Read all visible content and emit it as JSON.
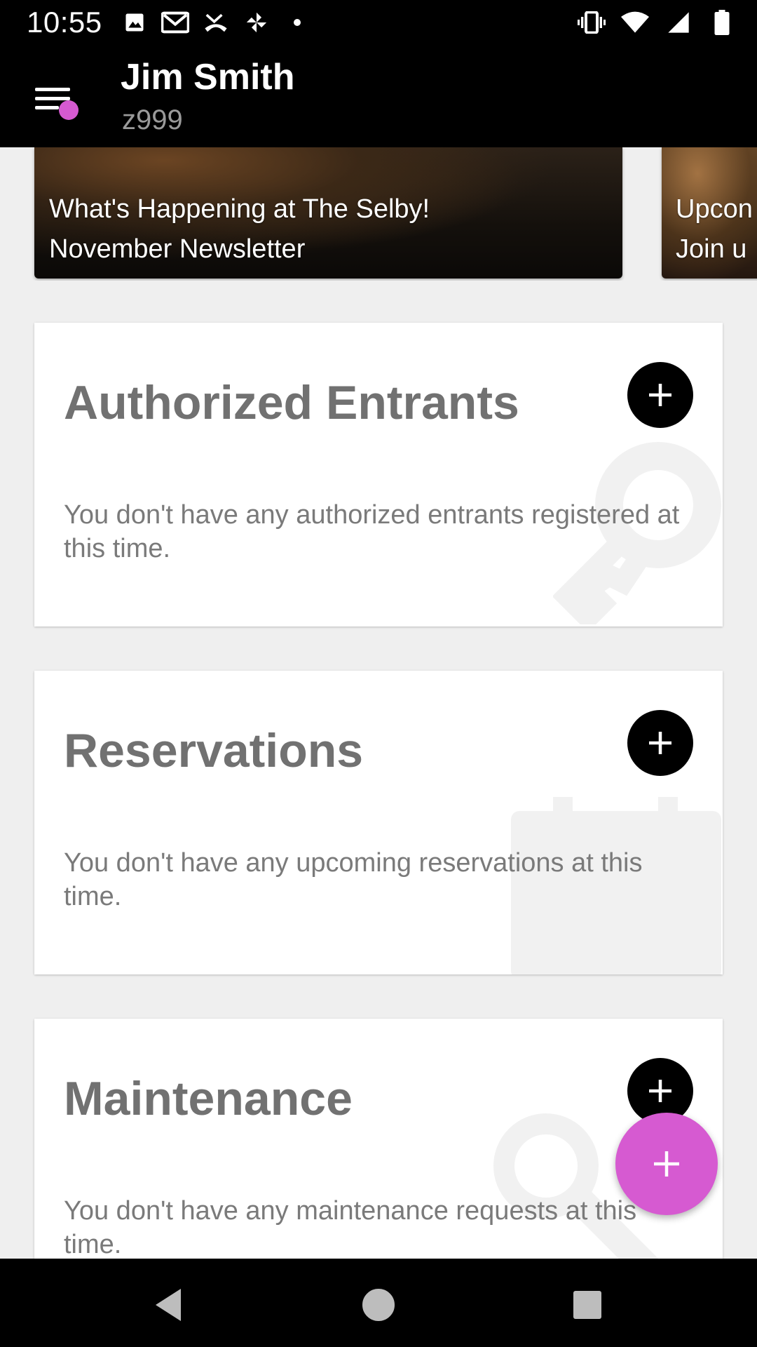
{
  "status_bar": {
    "time": "10:55",
    "left_icons": [
      "image-icon",
      "gmail-icon",
      "missed-call-icon",
      "pinwheel-icon",
      "dot-icon"
    ],
    "right_icons": [
      "vibrate-icon",
      "wifi-icon",
      "signal-icon",
      "battery-icon"
    ]
  },
  "app_bar": {
    "menu_icon": "menu-icon",
    "notification_dot_color": "#d65ad1",
    "user_name": "Jim Smith",
    "user_id": "z999"
  },
  "carousel": {
    "items": [
      {
        "line1": "What's Happening at The Selby!",
        "line2": "November Newsletter"
      },
      {
        "line1": "Upcon",
        "line2": "Join u"
      }
    ]
  },
  "cards": [
    {
      "title": "Authorized Entrants",
      "body": "You don't have any authorized entrants registered at this time.",
      "add_icon": "plus-icon",
      "background_icon": "key-icon"
    },
    {
      "title": "Reservations",
      "body": "You don't have any upcoming reservations at this time.",
      "add_icon": "plus-icon",
      "background_icon": "calendar-icon"
    },
    {
      "title": "Maintenance",
      "body": "You don't have any maintenance requests at this time.",
      "add_icon": "plus-icon",
      "background_icon": "wrench-icon"
    }
  ],
  "fab": {
    "icon": "plus-icon",
    "color": "#d65ad1"
  },
  "nav_bar": {
    "buttons": [
      "back-icon",
      "home-icon",
      "recents-icon"
    ]
  }
}
